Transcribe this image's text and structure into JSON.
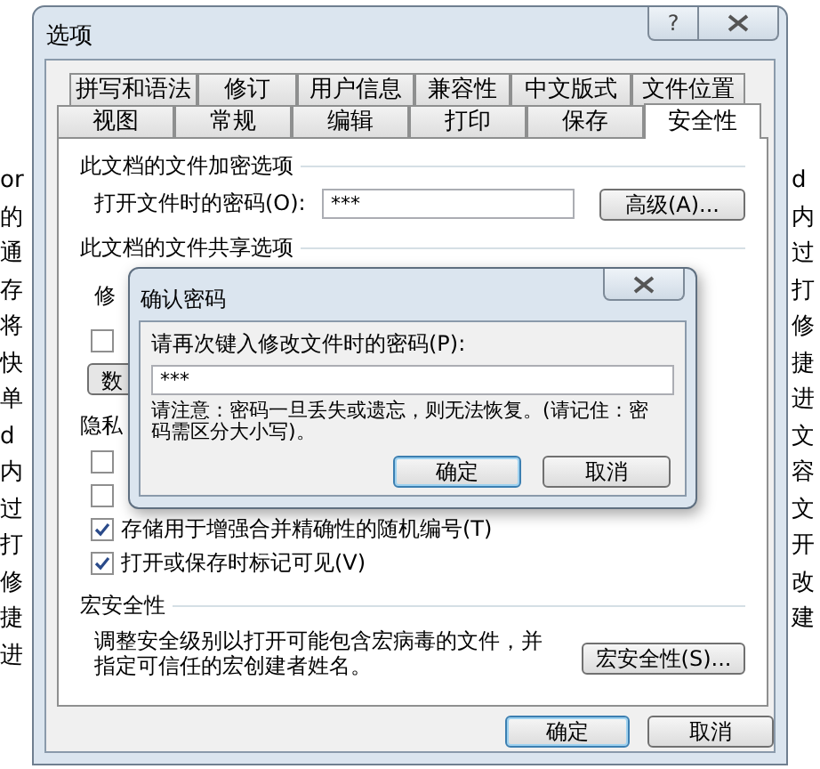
{
  "background_document": {
    "left_fragments": [
      "or",
      "的",
      "通",
      "存",
      "将",
      "快",
      "单",
      "d",
      "内",
      "过",
      "打",
      "修",
      "捷",
      "进"
    ],
    "right_fragments": [
      "d",
      "内",
      "过",
      "打",
      "修",
      "捷",
      "进",
      "文",
      "容",
      "文",
      "开",
      "改",
      "建"
    ]
  },
  "options_dialog": {
    "title": "选项",
    "help_button": "?",
    "tabs_row1": [
      {
        "label": "拼写和语法",
        "selected": false
      },
      {
        "label": "修订",
        "selected": false
      },
      {
        "label": "用户信息",
        "selected": false
      },
      {
        "label": "兼容性",
        "selected": false
      },
      {
        "label": "中文版式",
        "selected": false
      },
      {
        "label": "文件位置",
        "selected": false
      }
    ],
    "tabs_row2": [
      {
        "label": "视图",
        "selected": false
      },
      {
        "label": "常规",
        "selected": false
      },
      {
        "label": "编辑",
        "selected": false
      },
      {
        "label": "打印",
        "selected": false
      },
      {
        "label": "保存",
        "selected": false
      },
      {
        "label": "安全性",
        "selected": true
      }
    ],
    "encryption": {
      "title": "此文档的文件加密选项",
      "password_label": "打开文件时的密码(O):",
      "password_value": "***",
      "advanced_button": "高级(A)..."
    },
    "sharing": {
      "title": "此文档的文件共享选项",
      "modify_label": "修",
      "checkbox": {
        "checked": false
      },
      "button": "数"
    },
    "privacy": {
      "title": "隐私",
      "checkboxes": [
        {
          "checked": false
        },
        {
          "checked": false
        },
        {
          "label": "存储用于增强合并精确性的随机编号(T)",
          "checked": true
        },
        {
          "label": "打开或保存时标记可见(V)",
          "checked": true
        }
      ]
    },
    "macro": {
      "title": "宏安全性",
      "description": "调整安全级别以打开可能包含宏病毒的文件，并指定可信任的宏创建者姓名。",
      "button": "宏安全性(S)..."
    },
    "ok_button": "确定",
    "cancel_button": "取消"
  },
  "confirm_dialog": {
    "title": "确认密码",
    "label": "请再次键入修改文件时的密码(P):",
    "value": "***",
    "note": "请注意：密码一旦丢失或遗忘，则无法恢复。(请记住：密码需区分大小写)。",
    "ok_button": "确定",
    "cancel_button": "取消"
  }
}
